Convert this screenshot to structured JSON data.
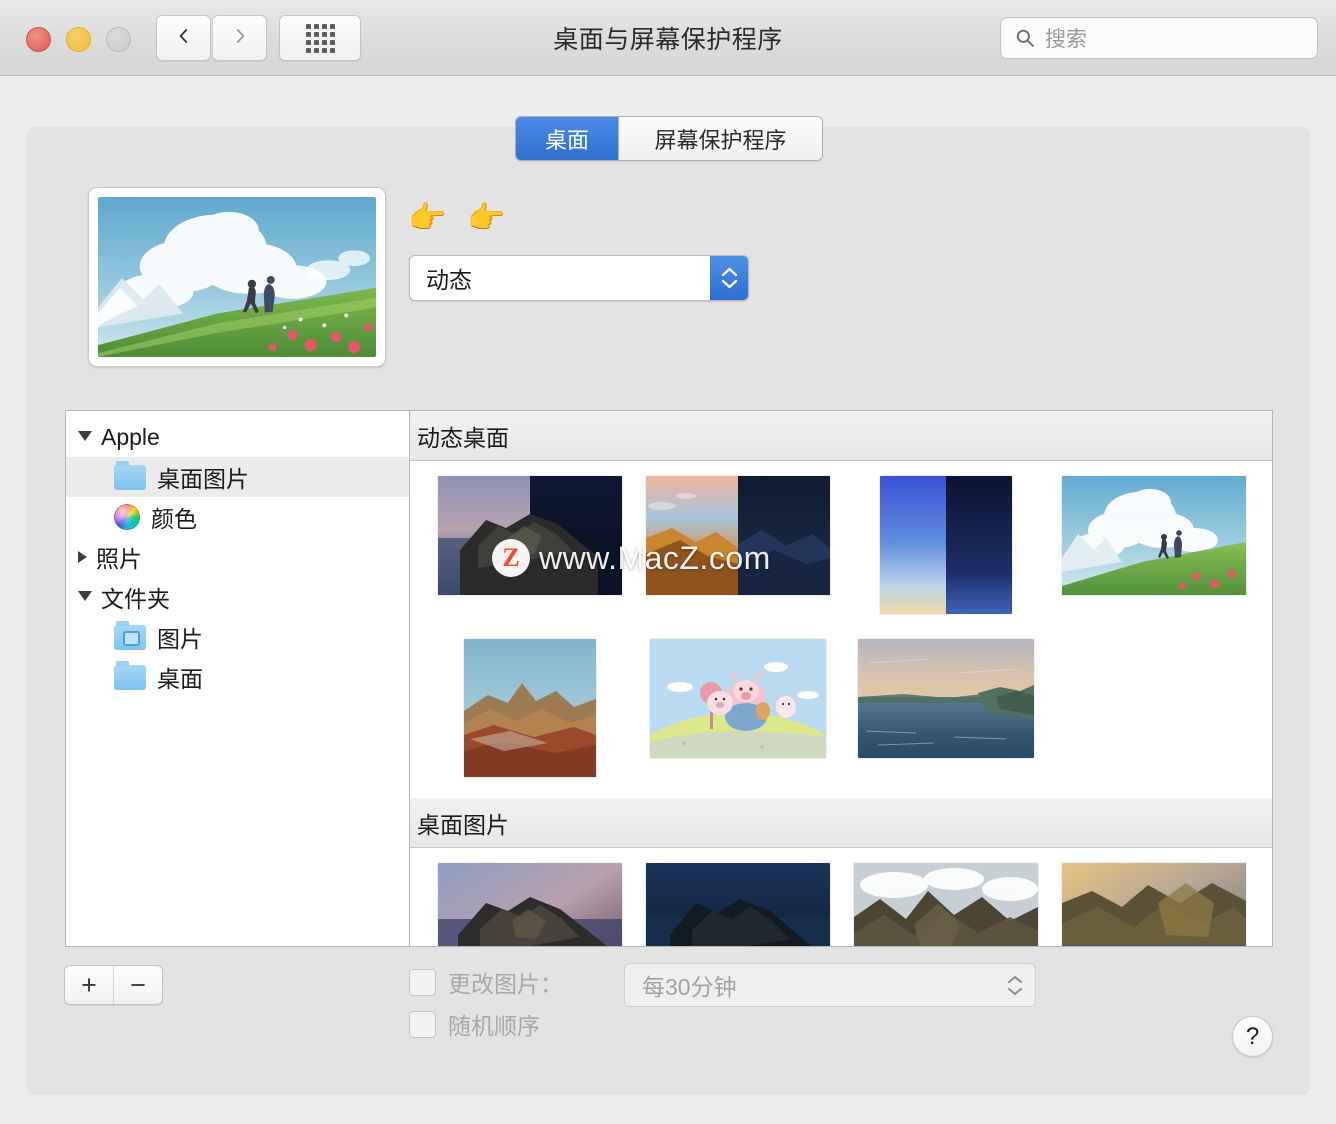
{
  "window": {
    "title": "桌面与屏幕保护程序",
    "traffic_lights": {
      "close": "close",
      "minimize": "minimize",
      "zoom": "zoom"
    }
  },
  "toolbar": {
    "back_icon": "chevron-left-icon",
    "forward_icon": "chevron-right-icon",
    "grid_icon": "grid-view-icon",
    "search": {
      "placeholder": "搜索",
      "value": "",
      "icon": "search-icon"
    }
  },
  "tabs": [
    {
      "label": "桌面",
      "active": true
    },
    {
      "label": "屏幕保护程序",
      "active": false
    }
  ],
  "preview": {
    "label": "current-desktop-preview"
  },
  "hint": {
    "emoji": "👉 👉"
  },
  "style_popup": {
    "value": "动态",
    "stepper_icon": "stepper-up-down-icon"
  },
  "sidebar": {
    "items": [
      {
        "label": "Apple",
        "type": "group",
        "expanded": true,
        "icon": "disclosure-open-icon",
        "selected": false
      },
      {
        "label": "桌面图片",
        "type": "child",
        "icon": "folder-icon",
        "selected": true
      },
      {
        "label": "颜色",
        "type": "child",
        "icon": "color-wheel-icon",
        "selected": false
      },
      {
        "label": "照片",
        "type": "group",
        "expanded": false,
        "icon": "disclosure-closed-icon",
        "selected": false
      },
      {
        "label": "文件夹",
        "type": "group",
        "expanded": true,
        "icon": "disclosure-open-icon",
        "selected": false
      },
      {
        "label": "图片",
        "type": "child",
        "icon": "folder-pictures-icon",
        "selected": false
      },
      {
        "label": "桌面",
        "type": "child",
        "icon": "folder-icon",
        "selected": false
      }
    ]
  },
  "sections": [
    {
      "title": "动态桌面",
      "rows": [
        [
          {
            "name": "catalina-dynamic",
            "shape": "wide"
          },
          {
            "name": "mojave-dynamic",
            "shape": "wide"
          },
          {
            "name": "solar-gradients-dynamic",
            "shape": "tall"
          },
          {
            "name": "anime-sky-dynamic",
            "shape": "wide",
            "selected": true
          }
        ],
        [
          {
            "name": "desert-mesa-dynamic",
            "shape": "tall"
          },
          {
            "name": "cartoon-pigs-dynamic",
            "shape": "sq"
          },
          {
            "name": "coastline-dynamic",
            "shape": "sq"
          }
        ]
      ]
    },
    {
      "title": "桌面图片",
      "rows": [
        [
          {
            "name": "catalina-day-still",
            "shape": "wide"
          },
          {
            "name": "catalina-night-still",
            "shape": "wide"
          },
          {
            "name": "cliffs-day-still",
            "shape": "wide"
          },
          {
            "name": "cliffs-sunset-still",
            "shape": "wide"
          }
        ]
      ]
    }
  ],
  "watermark": {
    "badge": "Z",
    "text": "www.MacZ.com"
  },
  "bottom": {
    "add_label": "+",
    "remove_label": "−",
    "change_picture": {
      "label": "更改图片：",
      "checked": false
    },
    "random_order": {
      "label": "随机顺序",
      "checked": false
    },
    "interval": {
      "value": "每30分钟"
    },
    "help_label": "?"
  },
  "colors": {
    "accent": "#2f6fd0",
    "window_bg": "#ececec",
    "panel_bg": "#e3e3e3",
    "selection": "#ebebeb",
    "watermark_orange": "#f04e23"
  }
}
